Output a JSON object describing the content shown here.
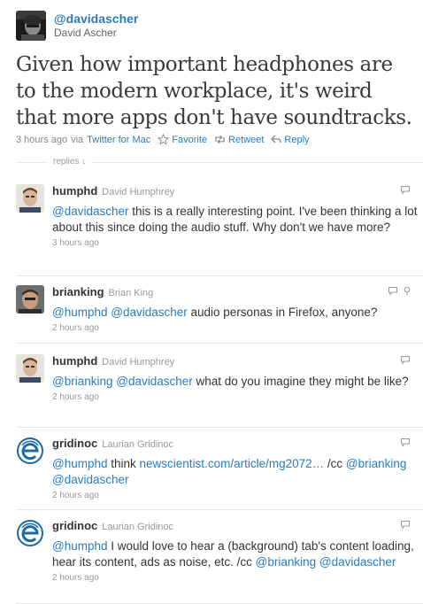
{
  "main": {
    "handle": "@davidascher",
    "name": "David Ascher",
    "text": "Given how important headphones are to the modern workplace, it's weird that more apps don't have soundtracks.",
    "time": "3 hours ago",
    "via_prefix": "via",
    "via_app": "Twitter for Mac",
    "favorite_label": "Favorite",
    "retweet_label": "Retweet",
    "reply_label": "Reply",
    "replies_label": "replies ↓"
  },
  "replies": [
    {
      "handle": "humphd",
      "name": "David Humphrey",
      "parts": [
        {
          "t": "@davidascher",
          "link": true
        },
        {
          "t": " this is a really interesting point. I've been thinking a lot about this since doing the audio stuff. Why don't we have more?",
          "link": false
        }
      ],
      "time": "3 hours ago",
      "avatar": "humphd",
      "icons": [
        "reply-icon"
      ]
    },
    {
      "handle": "brianking",
      "name": "Brian King",
      "parts": [
        {
          "t": "@humphd",
          "link": true
        },
        {
          "t": " ",
          "link": false
        },
        {
          "t": "@davidascher",
          "link": true
        },
        {
          "t": " audio personas in Firefox, anyone?",
          "link": false
        }
      ],
      "time": "2 hours ago",
      "avatar": "brianking",
      "icons": [
        "reply-icon",
        "location-icon"
      ]
    },
    {
      "handle": "humphd",
      "name": "David Humphrey",
      "parts": [
        {
          "t": "@brianking",
          "link": true
        },
        {
          "t": " ",
          "link": false
        },
        {
          "t": "@davidascher",
          "link": true
        },
        {
          "t": " what do you imagine they might be like?",
          "link": false
        }
      ],
      "time": "2 hours ago",
      "avatar": "humphd",
      "icons": [
        "reply-icon"
      ]
    },
    {
      "handle": "gridinoc",
      "name": "Laurian Gridinoc",
      "parts": [
        {
          "t": "@humphd",
          "link": true
        },
        {
          "t": " think ",
          "link": false
        },
        {
          "t": "newscientist.com/article/mg2072…",
          "link": true
        },
        {
          "t": " /cc ",
          "link": false
        },
        {
          "t": "@brianking",
          "link": true
        },
        {
          "t": " ",
          "link": false
        },
        {
          "t": "@davidascher",
          "link": true
        }
      ],
      "time": "2 hours ago",
      "avatar": "gridinoc",
      "icons": [
        "reply-icon"
      ]
    },
    {
      "handle": "gridinoc",
      "name": "Laurian Gridinoc",
      "parts": [
        {
          "t": "@humphd",
          "link": true
        },
        {
          "t": " I would love to hear a (background) tab's content loading, hear its content, ads as noise, etc. /cc ",
          "link": false
        },
        {
          "t": "@brianking",
          "link": true
        },
        {
          "t": " ",
          "link": false
        },
        {
          "t": "@davidascher",
          "link": true
        }
      ],
      "time": "2 hours ago",
      "avatar": "gridinoc",
      "icons": [
        "reply-icon"
      ]
    }
  ],
  "colors": {
    "link": "#2b7bb9",
    "text": "#333333",
    "muted": "#999999",
    "divider": "#e8e8e8"
  }
}
